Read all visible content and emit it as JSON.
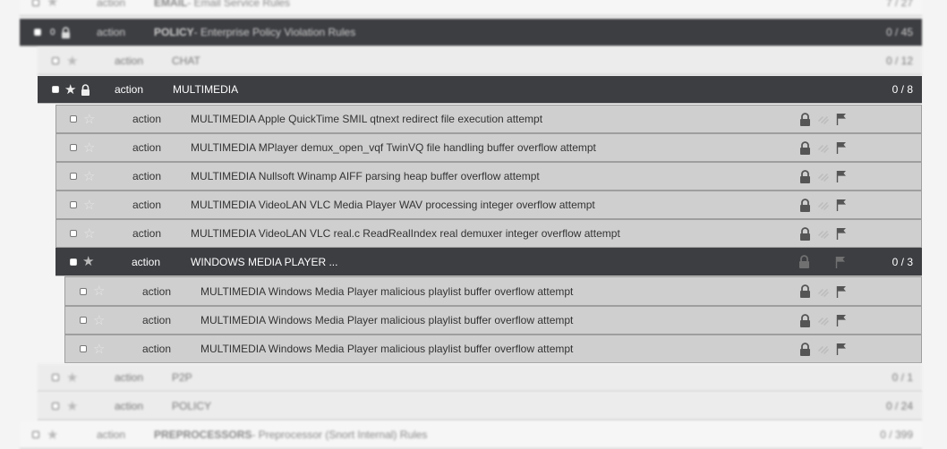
{
  "rows": [
    {
      "action": "action",
      "name": "EMAIL",
      "desc": " - Email Service Rules",
      "count": "7 / 27"
    },
    {
      "action": "action",
      "name": "POLICY",
      "desc": " - Enterprise Policy Violation Rules",
      "count": "0 / 45"
    },
    {
      "action": "action",
      "name": "CHAT",
      "count": "0 / 12"
    },
    {
      "action": "action",
      "name": "MULTIMEDIA",
      "count": "0 / 8"
    },
    {
      "action": "action",
      "name": "MULTIMEDIA Apple QuickTime SMIL qtnext redirect file execution attempt"
    },
    {
      "action": "action",
      "name": "MULTIMEDIA MPlayer demux_open_vqf TwinVQ file handling buffer overflow attempt"
    },
    {
      "action": "action",
      "name": "MULTIMEDIA Nullsoft Winamp AIFF parsing heap buffer overflow attempt"
    },
    {
      "action": "action",
      "name": "MULTIMEDIA VideoLAN VLC Media Player WAV processing integer overflow attempt"
    },
    {
      "action": "action",
      "name": "MULTIMEDIA VideoLAN VLC real.c ReadRealIndex real demuxer integer overflow attempt"
    },
    {
      "action": "action",
      "name": "WINDOWS MEDIA PLAYER ...",
      "count": "0 / 3"
    },
    {
      "action": "action",
      "name": "MULTIMEDIA Windows Media Player malicious playlist buffer overflow attempt"
    },
    {
      "action": "action",
      "name": "MULTIMEDIA Windows Media Player malicious playlist buffer overflow attempt"
    },
    {
      "action": "action",
      "name": "MULTIMEDIA Windows Media Player malicious playlist buffer overflow attempt"
    },
    {
      "action": "action",
      "name": "P2P",
      "count": "0 / 1"
    },
    {
      "action": "action",
      "name": "POLICY",
      "count": "0 / 24"
    },
    {
      "action": "action",
      "name": "PREPROCESSORS",
      "desc": " - Preprocessor (Snort Internal) Rules",
      "count": "0 / 399"
    }
  ],
  "icons": {
    "checkbox": "checkbox-icon",
    "star": "star-icon",
    "lock": "lock-icon",
    "link": "link-icon",
    "flag": "flag-icon"
  }
}
